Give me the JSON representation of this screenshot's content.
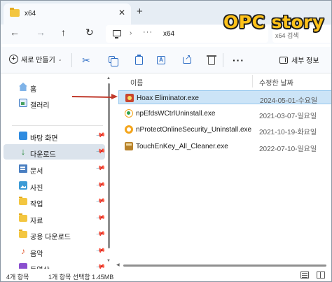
{
  "watermark": "OPC story",
  "tab": {
    "title": "x64",
    "close_icon": "close-icon",
    "new_tab_icon": "plus-icon"
  },
  "nav": {
    "back": "←",
    "forward": "→",
    "up": "↑",
    "refresh": "↻",
    "address_separator": "›",
    "address_more": "···",
    "breadcrumb": "x64",
    "search_placeholder": "x64 검색"
  },
  "commandbar": {
    "new_label": "새로 만들기",
    "new_plus": "+",
    "new_caret": "⌄",
    "cut": "✂",
    "more": "···",
    "details_label": "세부 정보",
    "rename_glyph": "A"
  },
  "sidebar": {
    "items": [
      {
        "label": "홈",
        "icon": "home-icon"
      },
      {
        "label": "갤러리",
        "icon": "gallery-icon"
      },
      {
        "label": "바탕 화면",
        "icon": "desktop-icon",
        "pinned": true
      },
      {
        "label": "다운로드",
        "icon": "download-icon",
        "pinned": true,
        "selected": true
      },
      {
        "label": "문서",
        "icon": "documents-icon",
        "pinned": true
      },
      {
        "label": "사진",
        "icon": "pictures-icon",
        "pinned": true
      },
      {
        "label": "작업",
        "icon": "folder-icon",
        "pinned": true
      },
      {
        "label": "자료",
        "icon": "folder-icon",
        "pinned": true
      },
      {
        "label": "공용 다운로드",
        "icon": "folder-icon",
        "pinned": true
      },
      {
        "label": "음악",
        "icon": "music-icon",
        "pinned": true
      },
      {
        "label": "동영상",
        "icon": "video-icon",
        "pinned": true
      }
    ],
    "pin_glyph": "📌",
    "download_glyph": "↓",
    "music_glyph": "♪"
  },
  "filelist": {
    "columns": {
      "name": "이름",
      "date": "수정한 날짜"
    },
    "rows": [
      {
        "name": "Hoax Eliminator.exe",
        "date": "2024-05-01-수요일",
        "icon": "hoax-app-icon",
        "selected": true
      },
      {
        "name": "npEfdsWCtrlUninstall.exe",
        "date": "2021-03-07-일요일",
        "icon": "np-uninstall-icon",
        "selected": false
      },
      {
        "name": "nProtectOnlineSecurity_Uninstall.exe",
        "date": "2021-10-19-화요일",
        "icon": "nprotect-icon",
        "selected": false
      },
      {
        "name": "TouchEnKey_All_Cleaner.exe",
        "date": "2022-07-10-일요일",
        "icon": "touchenkey-icon",
        "selected": false
      }
    ]
  },
  "statusbar": {
    "count": "4개 항목",
    "selection": "1개 항목 선택함 1.45MB"
  },
  "colors": {
    "selection_bg": "#cce4f7",
    "sidebar_selected": "#dbe3ec",
    "arrow": "#c0392b",
    "watermark": "#ffc21a"
  }
}
